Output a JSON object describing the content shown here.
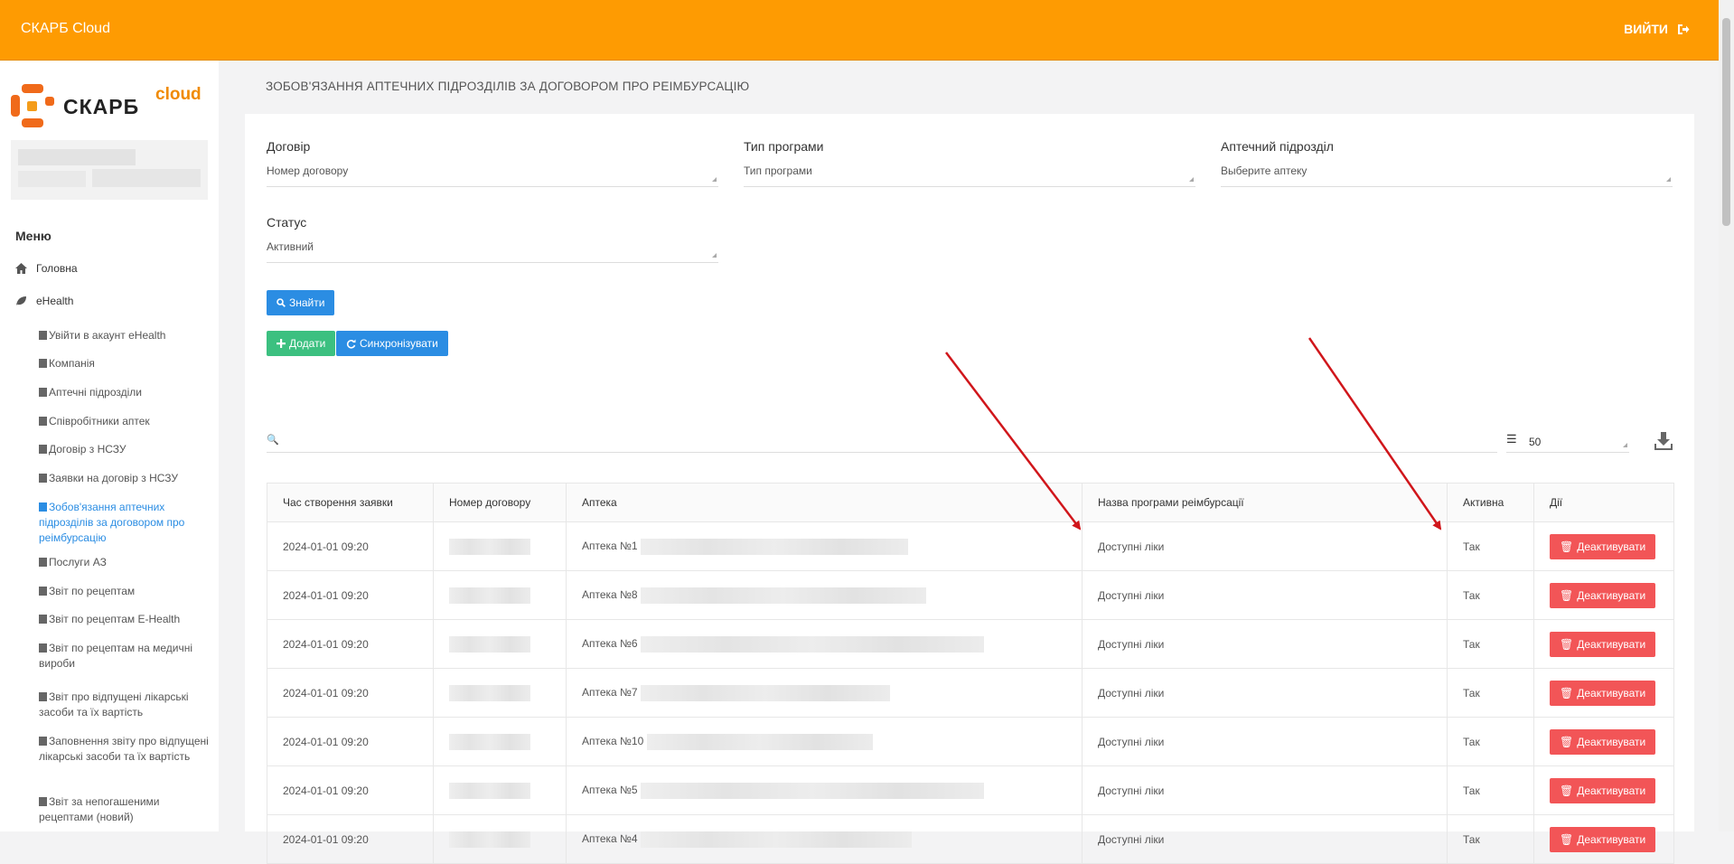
{
  "header": {
    "brand": "СКАРБ Cloud",
    "logout": "ВИЙТИ"
  },
  "logo": {
    "word": "СКАРБ",
    "cloud": "cloud"
  },
  "sidebar": {
    "menu_title": "Меню",
    "home": "Головна",
    "ehealth": "eHealth",
    "items": [
      {
        "label": "Увійти в акаунт eHealth"
      },
      {
        "label": "Компанія"
      },
      {
        "label": "Аптечні підрозділи"
      },
      {
        "label": "Співробітники аптек"
      },
      {
        "label": "Договір з НСЗУ"
      },
      {
        "label": "Заявки на договір з НСЗУ"
      },
      {
        "label": "Зобов'язання аптечних підрозділів за договором про реімбурсацію"
      },
      {
        "label": "Послуги АЗ"
      },
      {
        "label": "Звіт по рецептам"
      },
      {
        "label": "Звіт по рецептам E-Health"
      },
      {
        "label": "Звіт по рецептам на медичні вироби"
      },
      {
        "label": "Звіт про відпущені лікарські засоби та їх вартість"
      },
      {
        "label": "Заповнення звіту про відпущені лікарські засоби та їх вартість"
      },
      {
        "label": "Звіт за непогашеними рецептами (новий)"
      }
    ]
  },
  "page": {
    "title": "ЗОБОВ'ЯЗАННЯ АПТЕЧНИХ ПІДРОЗДІЛІВ ЗА ДОГОВОРОМ ПРО РЕІМБУРСАЦІЮ"
  },
  "filters": {
    "contract": {
      "label": "Договір",
      "placeholder": "Номер договору"
    },
    "program": {
      "label": "Тип програми",
      "placeholder": "Тип програми"
    },
    "pharmacy": {
      "label": "Аптечний підрозділ",
      "placeholder": "Выберите аптеку"
    },
    "status": {
      "label": "Статус",
      "value": "Активний"
    }
  },
  "buttons": {
    "find": "Знайти",
    "add": "Додати",
    "sync": "Синхронізувати",
    "deactivate": "Деактивувати"
  },
  "pager": {
    "per_page": "50"
  },
  "table": {
    "headers": [
      "Час створення заявки",
      "Номер договору",
      "Аптека",
      "Назва програми реімбурсації",
      "Активна",
      "Дії"
    ],
    "rows": [
      {
        "time": "2024-01-01 09:20",
        "pharmacy": "Аптека №1",
        "program": "Доступні ліки",
        "active": "Так"
      },
      {
        "time": "2024-01-01 09:20",
        "pharmacy": "Аптека №8",
        "program": "Доступні ліки",
        "active": "Так"
      },
      {
        "time": "2024-01-01 09:20",
        "pharmacy": "Аптека №6",
        "program": "Доступні ліки",
        "active": "Так"
      },
      {
        "time": "2024-01-01 09:20",
        "pharmacy": "Аптека №7",
        "program": "Доступні ліки",
        "active": "Так"
      },
      {
        "time": "2024-01-01 09:20",
        "pharmacy": "Аптека №10",
        "program": "Доступні ліки",
        "active": "Так"
      },
      {
        "time": "2024-01-01 09:20",
        "pharmacy": "Аптека №5",
        "program": "Доступні ліки",
        "active": "Так"
      },
      {
        "time": "2024-01-01 09:20",
        "pharmacy": "Аптека №4",
        "program": "Доступні ліки",
        "active": "Так"
      }
    ]
  },
  "colors": {
    "header": "#fe9b02",
    "primary": "#2b8de3",
    "success": "#3cc080",
    "danger": "#f25557",
    "arrow": "#d0161b"
  }
}
